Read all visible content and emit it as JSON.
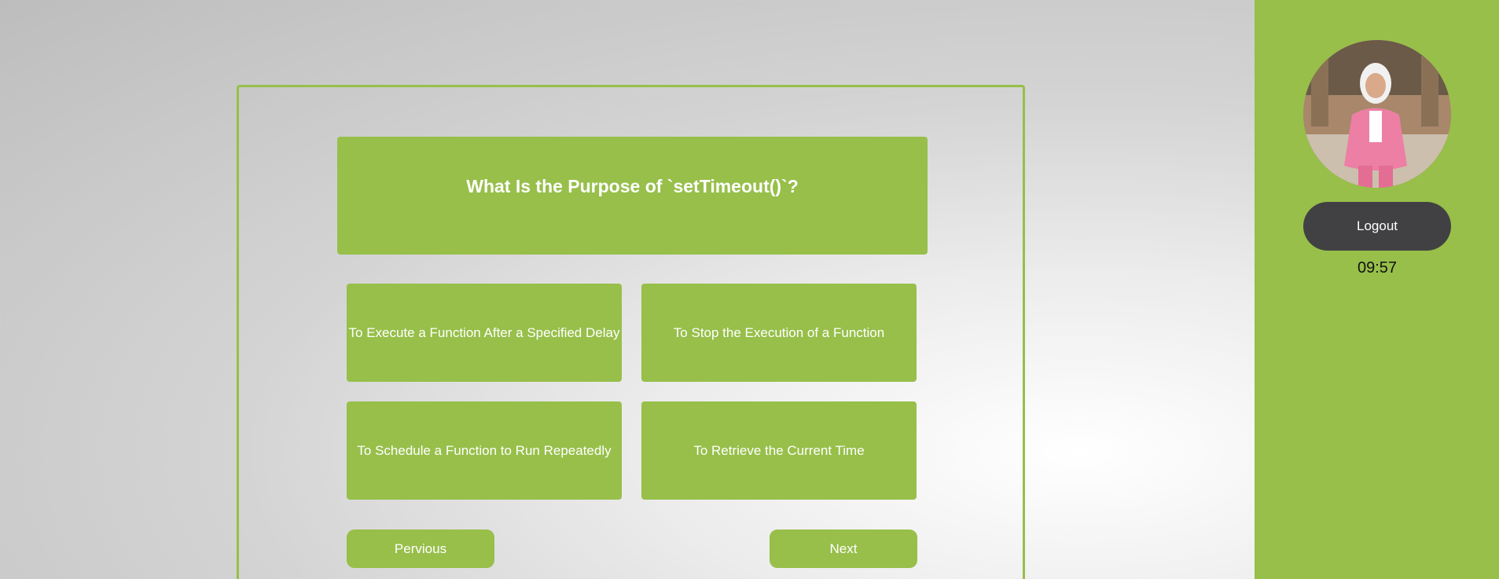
{
  "quiz": {
    "question": "What Is the Purpose of `setTimeout()`?",
    "answers": [
      "To Execute a Function After a Specified Delay",
      "To Stop the Execution of a Function",
      "To Schedule a Function to Run Repeatedly",
      "To Retrieve the Current Time"
    ],
    "prev_label": "Pervious",
    "next_label": "Next"
  },
  "sidebar": {
    "avatar_icon": "user-photo",
    "logout_label": "Logout",
    "timer": "09:57"
  },
  "colors": {
    "accent": "#97bf4a",
    "dark_button": "#414143",
    "text_on_accent": "#ffffff"
  }
}
